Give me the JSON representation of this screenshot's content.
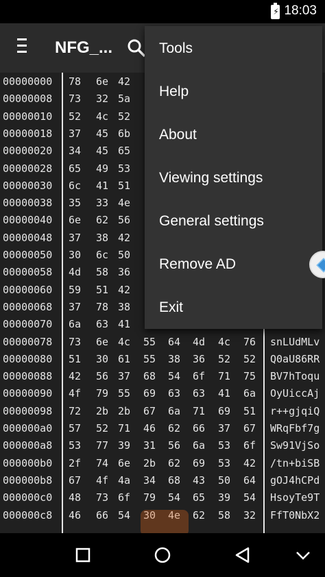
{
  "status_bar": {
    "time": "18:03"
  },
  "app_bar": {
    "title": "NFG_..."
  },
  "hex_view": {
    "rows": [
      {
        "offset": "00000000",
        "bytes": [
          "78",
          "6e",
          "42"
        ],
        "ascii": ""
      },
      {
        "offset": "00000008",
        "bytes": [
          "73",
          "32",
          "5a"
        ],
        "ascii": ""
      },
      {
        "offset": "00000010",
        "bytes": [
          "52",
          "4c",
          "52"
        ],
        "ascii": ""
      },
      {
        "offset": "00000018",
        "bytes": [
          "37",
          "45",
          "6b"
        ],
        "ascii": ""
      },
      {
        "offset": "00000020",
        "bytes": [
          "34",
          "45",
          "65"
        ],
        "ascii": ""
      },
      {
        "offset": "00000028",
        "bytes": [
          "65",
          "49",
          "53"
        ],
        "ascii": ""
      },
      {
        "offset": "00000030",
        "bytes": [
          "6c",
          "41",
          "51"
        ],
        "ascii": ""
      },
      {
        "offset": "00000038",
        "bytes": [
          "35",
          "33",
          "4e"
        ],
        "ascii": ""
      },
      {
        "offset": "00000040",
        "bytes": [
          "6e",
          "62",
          "56"
        ],
        "ascii": ""
      },
      {
        "offset": "00000048",
        "bytes": [
          "37",
          "38",
          "42"
        ],
        "ascii": ""
      },
      {
        "offset": "00000050",
        "bytes": [
          "30",
          "6c",
          "50"
        ],
        "ascii": ""
      },
      {
        "offset": "00000058",
        "bytes": [
          "4d",
          "58",
          "36"
        ],
        "ascii": ""
      },
      {
        "offset": "00000060",
        "bytes": [
          "59",
          "51",
          "42"
        ],
        "ascii": ""
      },
      {
        "offset": "00000068",
        "bytes": [
          "37",
          "78",
          "38"
        ],
        "ascii": ""
      },
      {
        "offset": "00000070",
        "bytes": [
          "6a",
          "63",
          "41"
        ],
        "ascii": ""
      },
      {
        "offset": "00000078",
        "bytes": [
          "73",
          "6e",
          "4c",
          "55",
          "64",
          "4d",
          "4c",
          "76"
        ],
        "ascii": "snLUdMLv"
      },
      {
        "offset": "00000080",
        "bytes": [
          "51",
          "30",
          "61",
          "55",
          "38",
          "36",
          "52",
          "52"
        ],
        "ascii": "Q0aU86RR"
      },
      {
        "offset": "00000088",
        "bytes": [
          "42",
          "56",
          "37",
          "68",
          "54",
          "6f",
          "71",
          "75"
        ],
        "ascii": "BV7hToqu"
      },
      {
        "offset": "00000090",
        "bytes": [
          "4f",
          "79",
          "55",
          "69",
          "63",
          "63",
          "41",
          "6a"
        ],
        "ascii": "OyUiccAj"
      },
      {
        "offset": "00000098",
        "bytes": [
          "72",
          "2b",
          "2b",
          "67",
          "6a",
          "71",
          "69",
          "51"
        ],
        "ascii": "r++gjqiQ"
      },
      {
        "offset": "000000a0",
        "bytes": [
          "57",
          "52",
          "71",
          "46",
          "62",
          "66",
          "37",
          "67"
        ],
        "ascii": "WRqFbf7g"
      },
      {
        "offset": "000000a8",
        "bytes": [
          "53",
          "77",
          "39",
          "31",
          "56",
          "6a",
          "53",
          "6f"
        ],
        "ascii": "Sw91VjSo"
      },
      {
        "offset": "000000b0",
        "bytes": [
          "2f",
          "74",
          "6e",
          "2b",
          "62",
          "69",
          "53",
          "42"
        ],
        "ascii": "/tn+biSB"
      },
      {
        "offset": "000000b8",
        "bytes": [
          "67",
          "4f",
          "4a",
          "34",
          "68",
          "43",
          "50",
          "64"
        ],
        "ascii": "gOJ4hCPd"
      },
      {
        "offset": "000000c0",
        "bytes": [
          "48",
          "73",
          "6f",
          "79",
          "54",
          "65",
          "39",
          "54"
        ],
        "ascii": "HsoyTe9T"
      },
      {
        "offset": "000000c8",
        "bytes": [
          "46",
          "66",
          "54",
          "30",
          "4e",
          "62",
          "58",
          "32"
        ],
        "ascii": "FfT0NbX2"
      }
    ]
  },
  "menu": {
    "items": [
      {
        "label": "Tools"
      },
      {
        "label": "Help"
      },
      {
        "label": "About"
      },
      {
        "label": "Viewing settings"
      },
      {
        "label": "General settings"
      },
      {
        "label": "Remove AD"
      },
      {
        "label": "Exit"
      }
    ]
  }
}
